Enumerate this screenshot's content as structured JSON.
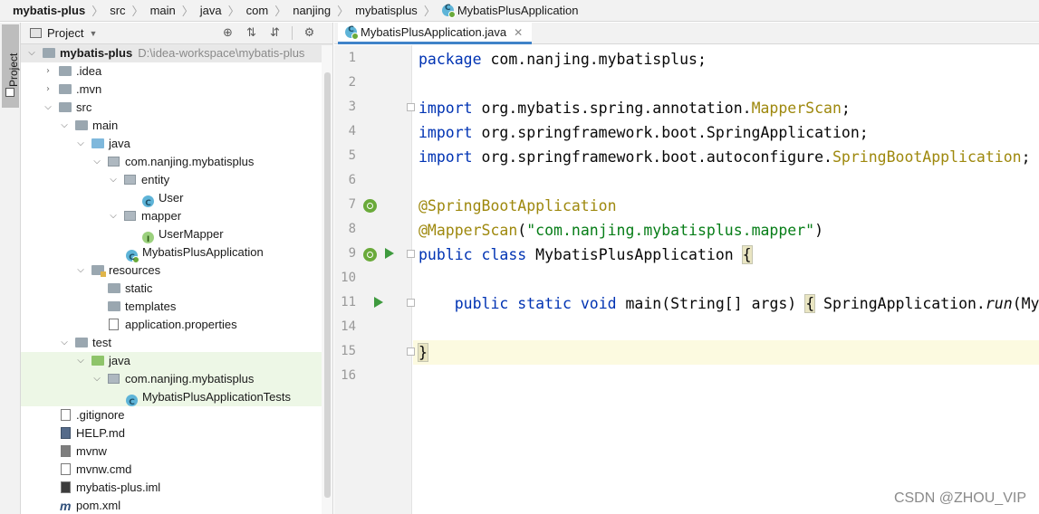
{
  "breadcrumb": {
    "items": [
      "mybatis-plus",
      "src",
      "main",
      "java",
      "com",
      "nanjing",
      "mybatisplus"
    ],
    "current": "MybatisPlusApplication"
  },
  "stripe": {
    "label": "Project"
  },
  "panel": {
    "title": "Project",
    "icons": [
      "locate-icon",
      "expand-all-icon",
      "collapse-all-icon",
      "gear-icon"
    ]
  },
  "tree": {
    "root_label": "mybatis-plus",
    "root_path": "D:\\idea-workspace\\mybatis-plus",
    "items": [
      ".idea",
      ".mvn",
      "src",
      "main",
      "java",
      "com.nanjing.mybatisplus",
      "entity",
      "User",
      "mapper",
      "UserMapper",
      "MybatisPlusApplication",
      "resources",
      "static",
      "templates",
      "application.properties",
      "test",
      "java",
      "com.nanjing.mybatisplus",
      "MybatisPlusApplicationTests",
      ".gitignore",
      "HELP.md",
      "mvnw",
      "mvnw.cmd",
      "mybatis-plus.iml",
      "pom.xml"
    ]
  },
  "editor": {
    "tab_label": "MybatisPlusApplication.java",
    "line_numbers": [
      "1",
      "2",
      "3",
      "4",
      "5",
      "6",
      "7",
      "8",
      "9",
      "10",
      "11",
      "14",
      "15",
      "16"
    ],
    "code": {
      "l1_kw": "package",
      "l1_rest": " com.nanjing.mybatisplus;",
      "l3_kw": "import",
      "l3_rest": " org.mybatis.spring.annotation.",
      "l3_type": "MapperScan",
      "l3_end": ";",
      "l4_kw": "import",
      "l4_rest": " org.springframework.boot.SpringApplication;",
      "l5_kw": "import",
      "l5_rest": " org.springframework.boot.autoconfigure.",
      "l5_type": "SpringBootApplication",
      "l5_end": ";",
      "l7_ann": "@SpringBootApplication",
      "l8_ann": "@MapperScan",
      "l8_open": "(",
      "l8_str": "\"com.nanjing.mybatisplus.mapper\"",
      "l8_close": ")",
      "l9_kw": "public class",
      "l9_name": " MybatisPlusApplication ",
      "l9_brace": "{",
      "l11_kw": "public static void",
      "l11_mid": " main(String[] args) ",
      "l11_brace": "{",
      "l11_call": " SpringApplication.",
      "l11_run": "run",
      "l11_end": "(My",
      "l15_brace": "}"
    }
  },
  "watermark": "CSDN @ZHOU_VIP"
}
